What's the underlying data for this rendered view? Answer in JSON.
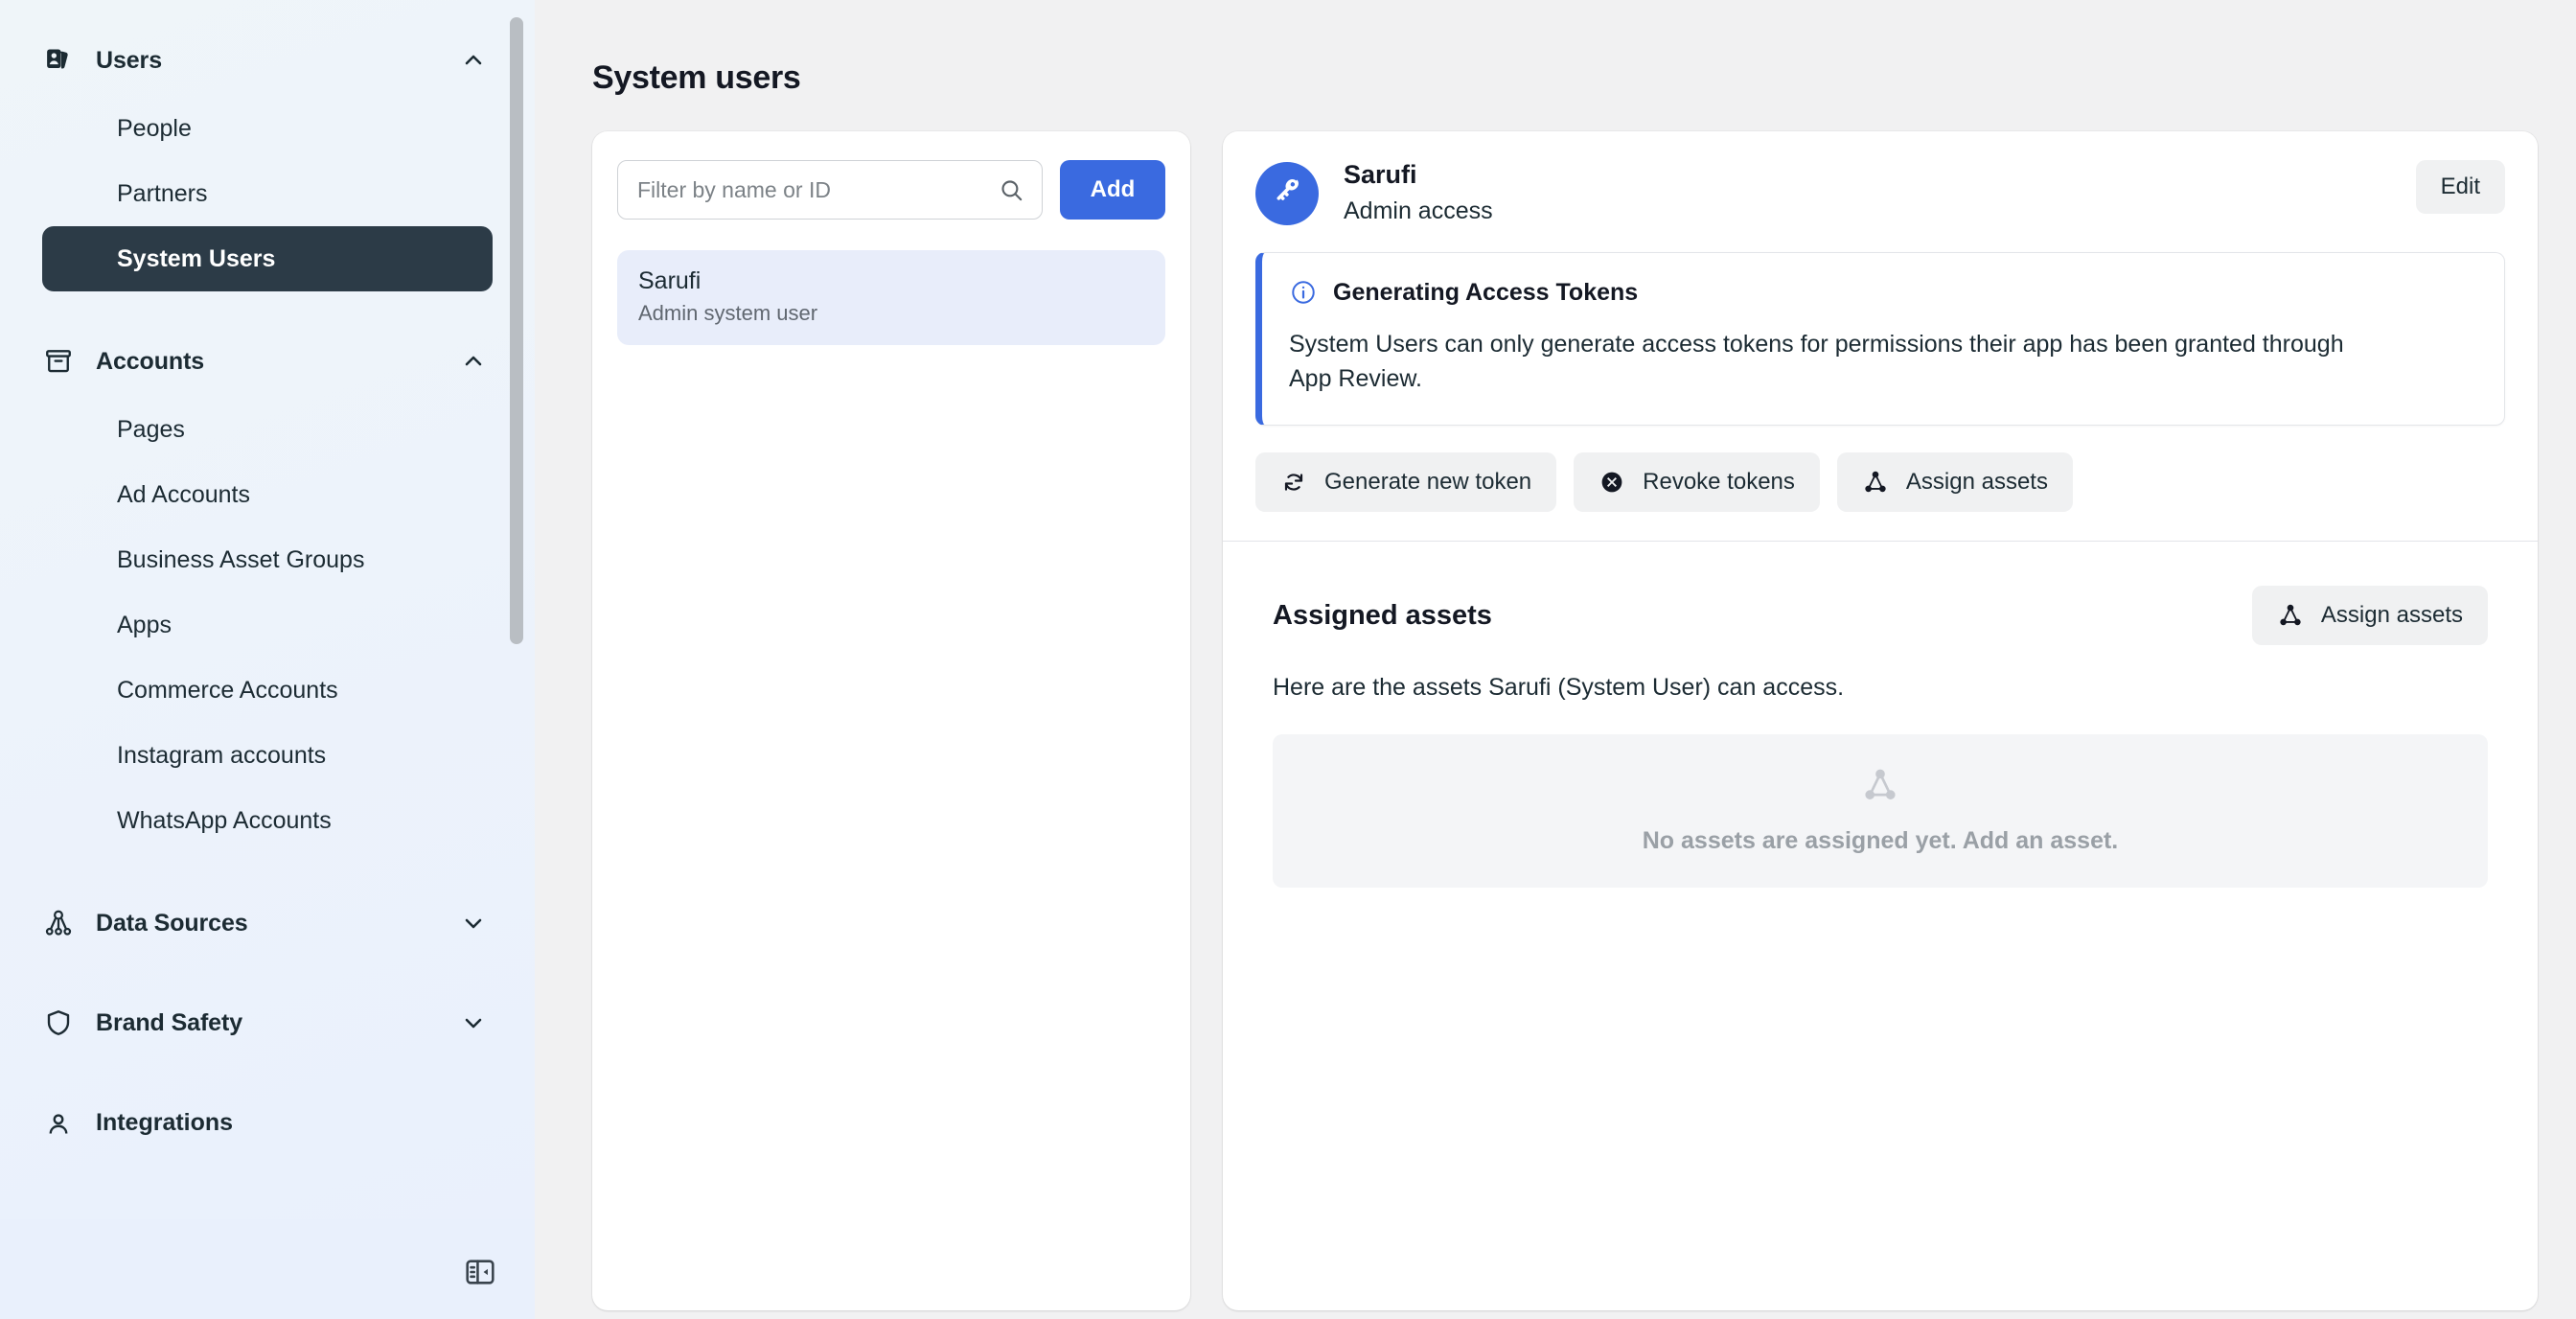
{
  "sidebar": {
    "groups": [
      {
        "label": "Users",
        "icon": "id-badge-icon",
        "expanded": true,
        "chevron": "chevron-up-icon",
        "children": [
          {
            "label": "People",
            "active": false
          },
          {
            "label": "Partners",
            "active": false
          },
          {
            "label": "System Users",
            "active": true
          }
        ]
      },
      {
        "label": "Accounts",
        "icon": "archive-box-icon",
        "expanded": true,
        "chevron": "chevron-up-icon",
        "children": [
          {
            "label": "Pages",
            "active": false
          },
          {
            "label": "Ad Accounts",
            "active": false
          },
          {
            "label": "Business Asset Groups",
            "active": false
          },
          {
            "label": "Apps",
            "active": false
          },
          {
            "label": "Commerce Accounts",
            "active": false
          },
          {
            "label": "Instagram accounts",
            "active": false
          },
          {
            "label": "WhatsApp Accounts",
            "active": false
          }
        ]
      },
      {
        "label": "Data Sources",
        "icon": "data-sources-icon",
        "expanded": false,
        "chevron": "chevron-down-icon",
        "children": []
      },
      {
        "label": "Brand Safety",
        "icon": "shield-icon",
        "expanded": false,
        "chevron": "chevron-down-icon",
        "children": []
      }
    ],
    "collapse_icon": "panel-collapse-icon",
    "scrollbar": "sidebar-scrollbar"
  },
  "main": {
    "page_title": "System users",
    "list": {
      "filter_placeholder": "Filter by name or ID",
      "filter_value": "",
      "search_icon": "search-icon",
      "add_label": "Add",
      "users": [
        {
          "name": "Sarufi",
          "role": "Admin system user",
          "selected": true
        }
      ]
    },
    "detail": {
      "avatar_icon": "key-icon",
      "name": "Sarufi",
      "access": "Admin access",
      "edit_label": "Edit",
      "callout": {
        "icon": "info-circle-icon",
        "title": "Generating Access Tokens",
        "body": "System Users can only generate access tokens for permissions their app has been granted through App Review."
      },
      "actions": [
        {
          "label": "Generate new token",
          "icon": "refresh-icon"
        },
        {
          "label": "Revoke tokens",
          "icon": "x-circle-icon"
        },
        {
          "label": "Assign assets",
          "icon": "assets-graph-icon"
        }
      ],
      "assets": {
        "title": "Assigned assets",
        "assign_label": "Assign assets",
        "assign_icon": "assets-graph-icon",
        "description": "Here are the assets Sarufi (System User) can access.",
        "empty_icon": "assets-graph-icon",
        "empty_text": "No assets are assigned yet. Add an asset."
      }
    }
  },
  "colors": {
    "accent_blue": "#3a6ae0",
    "active_nav": "#2c3b47",
    "selected_row": "#e8edfa",
    "main_bg": "#f1f1f2",
    "button_grey": "#f0f1f2"
  }
}
